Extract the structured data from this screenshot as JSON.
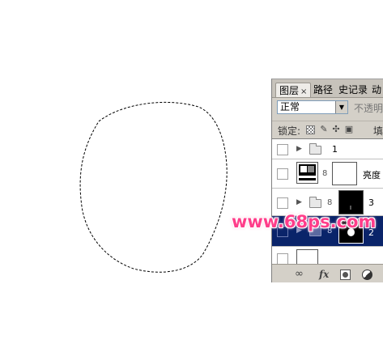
{
  "panel": {
    "tabs": {
      "layers": "图层",
      "close": "×",
      "paths": "路径",
      "history": "史记录",
      "actions": "动"
    },
    "blend_mode": "正常",
    "opacity_label": "不透明",
    "lock_label": "锁定:",
    "fill_label": "填",
    "layers": [
      {
        "name": "1",
        "type": "group",
        "selected": false
      },
      {
        "name": "亮度",
        "type": "adjustment",
        "selected": false
      },
      {
        "name": "3",
        "type": "group-masked",
        "selected": false
      },
      {
        "name": "2",
        "type": "group-masked",
        "selected": true
      }
    ]
  },
  "icons": {
    "lock_brush": "✎",
    "lock_move": "✣",
    "lock_all": "🔒",
    "chain": "8",
    "link": "∞",
    "fx": "fx",
    "triangle": "▶"
  },
  "watermark": "www.68ps.com"
}
